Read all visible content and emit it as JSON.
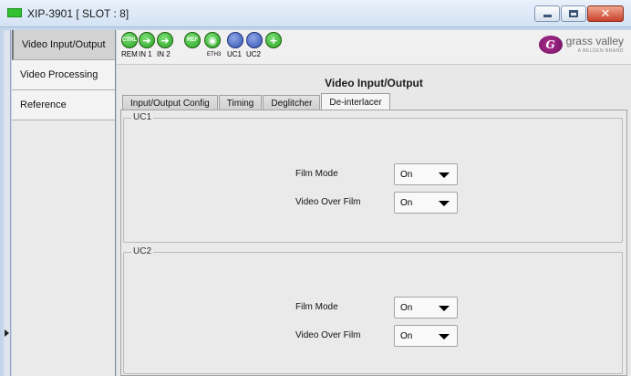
{
  "window": {
    "title": "XIP-3901 [ SLOT : 8]",
    "close_glyph": "✕"
  },
  "sidebar": {
    "items": [
      {
        "label": "Video Input/Output",
        "active": true
      },
      {
        "label": "Video Processing",
        "active": false
      },
      {
        "label": "Reference",
        "active": false
      }
    ]
  },
  "toolbar": {
    "status_icons": [
      {
        "name": "ctrl-icon",
        "text": "CTRL",
        "caption": "REM",
        "color": "green"
      },
      {
        "name": "in1-icon",
        "text": "➜",
        "caption": "IN 1",
        "color": "green"
      },
      {
        "name": "in2-icon",
        "text": "➜",
        "caption": "IN 2",
        "color": "green"
      },
      {
        "name": "ref-icon",
        "text": "REF",
        "caption": "",
        "color": "green"
      },
      {
        "name": "eth-icon",
        "text": "◉",
        "caption": "ETH",
        "color": "green"
      },
      {
        "name": "uc1-icon",
        "text": "",
        "caption": "UC1",
        "color": "blue"
      },
      {
        "name": "uc2-icon",
        "text": "",
        "caption": "UC2",
        "color": "blue"
      },
      {
        "name": "add-icon",
        "text": "+",
        "caption": "",
        "color": "green"
      }
    ],
    "eth_suffix": "3"
  },
  "logo": {
    "text": "grass valley",
    "sub": "A BELDEN BRAND",
    "mark": "G"
  },
  "panel": {
    "title": "Video Input/Output"
  },
  "tabs": [
    {
      "label": "Input/Output Config",
      "active": false
    },
    {
      "label": "Timing",
      "active": false
    },
    {
      "label": "Deglitcher",
      "active": false
    },
    {
      "label": "De-interlacer",
      "active": true
    }
  ],
  "groups": [
    {
      "label": "UC1",
      "rows": [
        {
          "label": "Film Mode",
          "value": "On"
        },
        {
          "label": "Video Over Film",
          "value": "On"
        }
      ]
    },
    {
      "label": "UC2",
      "rows": [
        {
          "label": "Film Mode",
          "value": "On"
        },
        {
          "label": "Video Over Film",
          "value": "On"
        }
      ]
    }
  ],
  "colors": {
    "active_status": "#26a31f",
    "uc_status": "#3353b4",
    "brand": "#8a1a78",
    "close_button": "#c8402a"
  }
}
